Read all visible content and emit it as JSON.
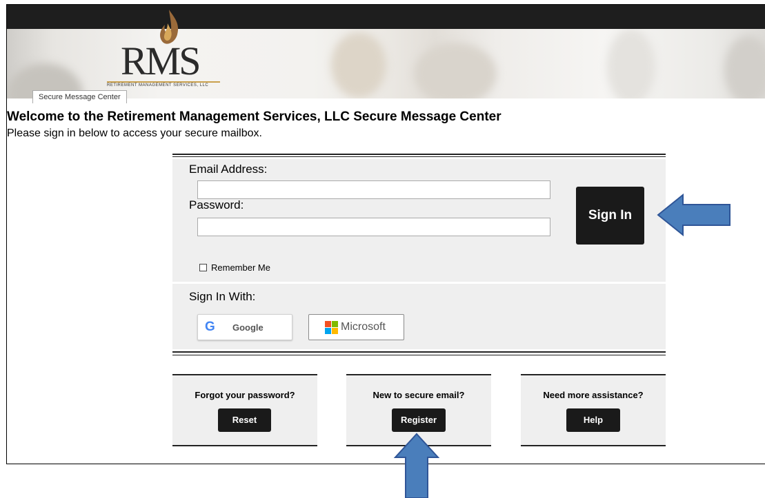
{
  "header": {
    "logo_text": "RMS",
    "logo_subtext": "RETIREMENT MANAGEMENT SERVICES, LLC",
    "tab_label": "Secure Message Center"
  },
  "welcome": {
    "title": "Welcome to the Retirement Management Services, LLC Secure Message Center",
    "subtitle": "Please sign in below to access your secure mailbox."
  },
  "login": {
    "email_label": "Email Address:",
    "email_value": "",
    "password_label": "Password:",
    "password_value": "",
    "sign_in_button": "Sign In",
    "remember_me": "Remember Me",
    "remember_checked": false,
    "sign_in_with_label": "Sign In With:",
    "google_label": "Google",
    "google_icon_text": "G",
    "microsoft_label": "Microsoft"
  },
  "help_cards": [
    {
      "question": "Forgot your password?",
      "button": "Reset"
    },
    {
      "question": "New to secure email?",
      "button": "Register"
    },
    {
      "question": "Need more assistance?",
      "button": "Help"
    }
  ],
  "colors": {
    "annotation_arrow_fill": "#4a7ebb",
    "annotation_arrow_stroke": "#2f5597",
    "button_bg": "#1a1a1a",
    "panel_bg": "#efefef",
    "logo_gold": "#c9a04c"
  }
}
